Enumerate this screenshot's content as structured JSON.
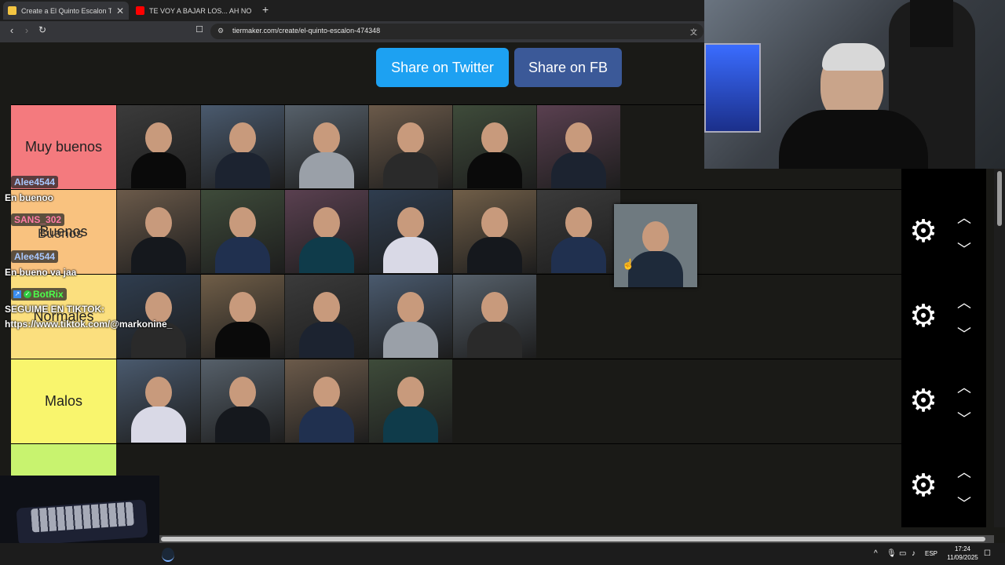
{
  "browser": {
    "tabs": [
      {
        "title": "Create a El Quinto Escalon Tier L",
        "favicon_color": "#f4c542",
        "active": true
      },
      {
        "title": "TE VOY A BAJAR LOS... AH NO PARA",
        "favicon_color": "#ff0000",
        "active": false
      }
    ],
    "new_tab": "+",
    "url": "tiermaker.com/create/el-quinto-escalon-474348"
  },
  "share": {
    "twitter": "Share on Twitter",
    "facebook": "Share on FB"
  },
  "tiers": [
    {
      "label": "Muy buenos",
      "color": "#f47a7e",
      "count": 6
    },
    {
      "label": "Buenos",
      "color": "#f9c27f",
      "count": 6
    },
    {
      "label": "Normales",
      "color": "#fbdf7e",
      "count": 5
    },
    {
      "label": "Malos",
      "color": "#f9f56d",
      "count": 4
    },
    {
      "label": "",
      "color": "#c8f36f",
      "count": 0
    }
  ],
  "chat": [
    {
      "user": "Alee4544",
      "user_color": "#a9c8ff",
      "message": "En buenoo"
    },
    {
      "user": "SANS_302",
      "user_color": "#ff7aa6",
      "message": "Buenos"
    },
    {
      "user": "Alee4544",
      "user_color": "#a9c8ff",
      "message": "En bueno va jaa"
    },
    {
      "user": "BotRix",
      "user_color": "#4cff4c",
      "message": "SEGUIME EN TIKTOK:",
      "link": "https://www.tiktok.com/@markonine_"
    }
  ],
  "taskbar": {
    "language": "ESP",
    "time": "17:24",
    "date": "11/09/2025"
  },
  "icons": [
    "settings-gear-icon",
    "chevron-up-icon",
    "chevron-down-icon",
    "back-arrow-icon",
    "forward-arrow-icon",
    "reload-icon",
    "bookmark-icon",
    "translate-icon",
    "site-info-icon",
    "close-icon"
  ],
  "colors": {
    "twitter": "#1da1f2",
    "facebook": "#3b5998",
    "page_bg": "#1a1a17"
  }
}
